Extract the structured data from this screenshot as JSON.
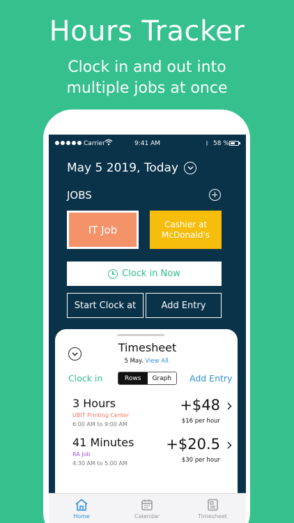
{
  "promo": {
    "title": "Hours Tracker",
    "subtitle_line1": "Clock in and out into",
    "subtitle_line2": "multiple jobs at once"
  },
  "status_bar": {
    "carrier": "Carrier",
    "time": "9:41 AM",
    "battery_percent": "58 %",
    "battery_level": 0.58
  },
  "header": {
    "date": "May 5 2019, Today"
  },
  "jobs": {
    "label": "JOBS",
    "items": [
      {
        "name": "IT Job",
        "color": "#f4926a",
        "selected": true
      },
      {
        "name": "Cashier at McDonald's",
        "color": "#f7bd0c",
        "selected": false
      }
    ]
  },
  "actions": {
    "clock_in_now": "Clock in Now",
    "start_clock_at": "Start Clock at",
    "add_entry": "Add Entry"
  },
  "timesheet": {
    "title": "Timesheet",
    "date": "5 May.",
    "view_all": "View All.",
    "clock_in_label": "Clock in",
    "view_options": [
      "Rows",
      "Graph"
    ],
    "selected_view": "Rows",
    "add_entry_link": "Add Entry",
    "entries": [
      {
        "duration": "3 Hours",
        "job": "UBIT Printing Center",
        "job_color": "#f0735a",
        "time_range": "6:00 AM to 9:00 AM",
        "amount": "+$48",
        "rate": "$16 per hour"
      },
      {
        "duration": "41 Minutes",
        "job": "RA Job",
        "job_color": "#9b4fd1",
        "time_range": "4:30 AM to 5:00 AM",
        "amount": "+$20.5",
        "rate": "$30 per hour"
      }
    ]
  },
  "tabbar": {
    "items": [
      {
        "label": "Home",
        "icon": "home-icon",
        "active": true
      },
      {
        "label": "Calendar",
        "icon": "calendar-icon",
        "active": false
      },
      {
        "label": "Timesheet",
        "icon": "timesheet-icon",
        "active": false
      }
    ]
  },
  "colors": {
    "background": "#35c08e",
    "app_navy": "#0a334a",
    "accent_green": "#2ebd8a",
    "link_blue": "#2e8fd6"
  }
}
